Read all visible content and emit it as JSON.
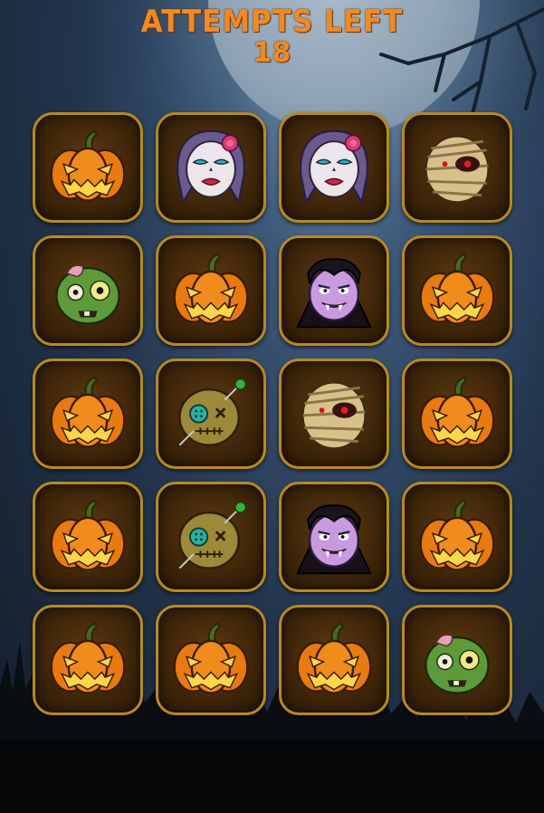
{
  "header": {
    "title": "ATTEMPTS LEFT",
    "attempts_left": "18"
  },
  "colors": {
    "title": "#f08a24",
    "card_border": "#b88a1c",
    "card_bg": "#3e2509"
  },
  "board": {
    "columns": 4,
    "rows": 5,
    "cards": [
      "pumpkin-icon",
      "sugar-skull-girl-icon",
      "sugar-skull-girl-icon",
      "mummy-icon",
      "zombie-icon",
      "pumpkin-icon",
      "vampire-icon",
      "pumpkin-icon",
      "pumpkin-icon",
      "voodoo-doll-icon",
      "mummy-icon",
      "pumpkin-icon",
      "pumpkin-icon",
      "voodoo-doll-icon",
      "vampire-icon",
      "pumpkin-icon",
      "pumpkin-icon",
      "pumpkin-icon",
      "pumpkin-icon",
      "zombie-icon"
    ]
  }
}
